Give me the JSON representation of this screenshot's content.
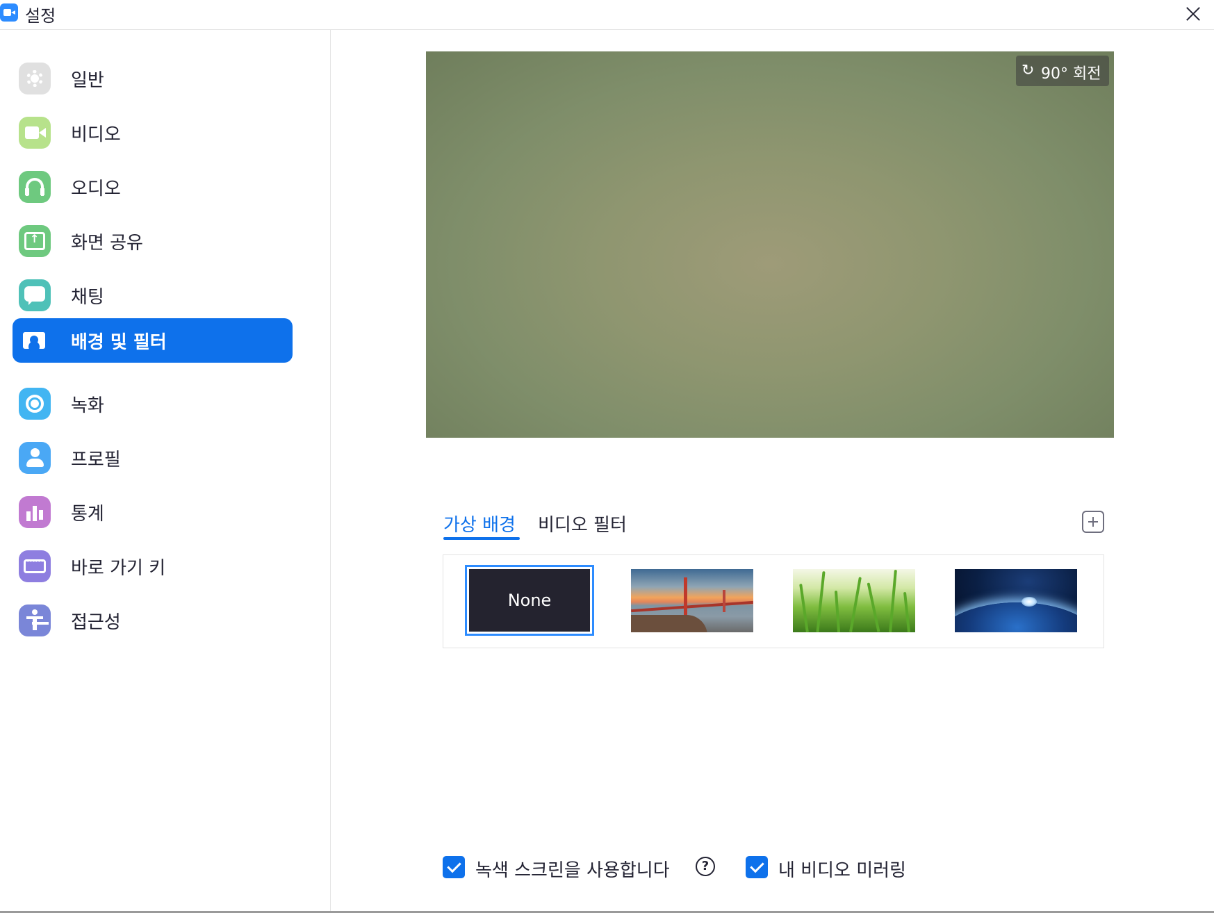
{
  "window": {
    "title": "설정",
    "app_icon": "zoom-camera-icon",
    "close_icon": "close-icon"
  },
  "sidebar": {
    "items": [
      {
        "label": "일반",
        "icon": "gear-icon",
        "color": "#e0e0e0",
        "active": false
      },
      {
        "label": "비디오",
        "icon": "video-camera-icon",
        "color": "#b7e28b",
        "active": false
      },
      {
        "label": "오디오",
        "icon": "headphones-icon",
        "color": "#6ec97f",
        "active": false
      },
      {
        "label": "화면 공유",
        "icon": "share-screen-icon",
        "color": "#6ec97f",
        "active": false
      },
      {
        "label": "채팅",
        "icon": "chat-bubble-icon",
        "color": "#4fc1b8",
        "active": false
      },
      {
        "label": "배경 및 필터",
        "icon": "background-portrait-icon",
        "color": "#0e71eb",
        "active": true
      },
      {
        "label": "녹화",
        "icon": "record-icon",
        "color": "#42b5f2",
        "active": false
      },
      {
        "label": "프로필",
        "icon": "profile-icon",
        "color": "#4aa8f5",
        "active": false
      },
      {
        "label": "통계",
        "icon": "bar-chart-icon",
        "color": "#c17ad1",
        "active": false
      },
      {
        "label": "바로 가기 키",
        "icon": "keyboard-icon",
        "color": "#8e7ee0",
        "active": false
      },
      {
        "label": "접근성",
        "icon": "accessibility-icon",
        "color": "#7a86d8",
        "active": false
      }
    ]
  },
  "preview": {
    "rotate_label": "90° 회전",
    "rotate_icon": "rotate-icon"
  },
  "tabs": [
    {
      "label": "가상 배경",
      "active": true
    },
    {
      "label": "비디오 필터",
      "active": false
    }
  ],
  "add_button_icon": "plus-icon",
  "backgrounds": [
    {
      "label": "None",
      "selected": true
    },
    {
      "label": "",
      "image": "golden-gate-bridge"
    },
    {
      "label": "",
      "image": "grass"
    },
    {
      "label": "",
      "image": "earth-from-space"
    }
  ],
  "options": {
    "green_screen": {
      "label": "녹색 스크린을 사용합니다",
      "checked": true,
      "help_icon": "?"
    },
    "mirror": {
      "label": "내 비디오 미러링",
      "checked": true
    }
  },
  "colors": {
    "accent": "#0e71eb",
    "selection_border": "#2d8cff"
  }
}
